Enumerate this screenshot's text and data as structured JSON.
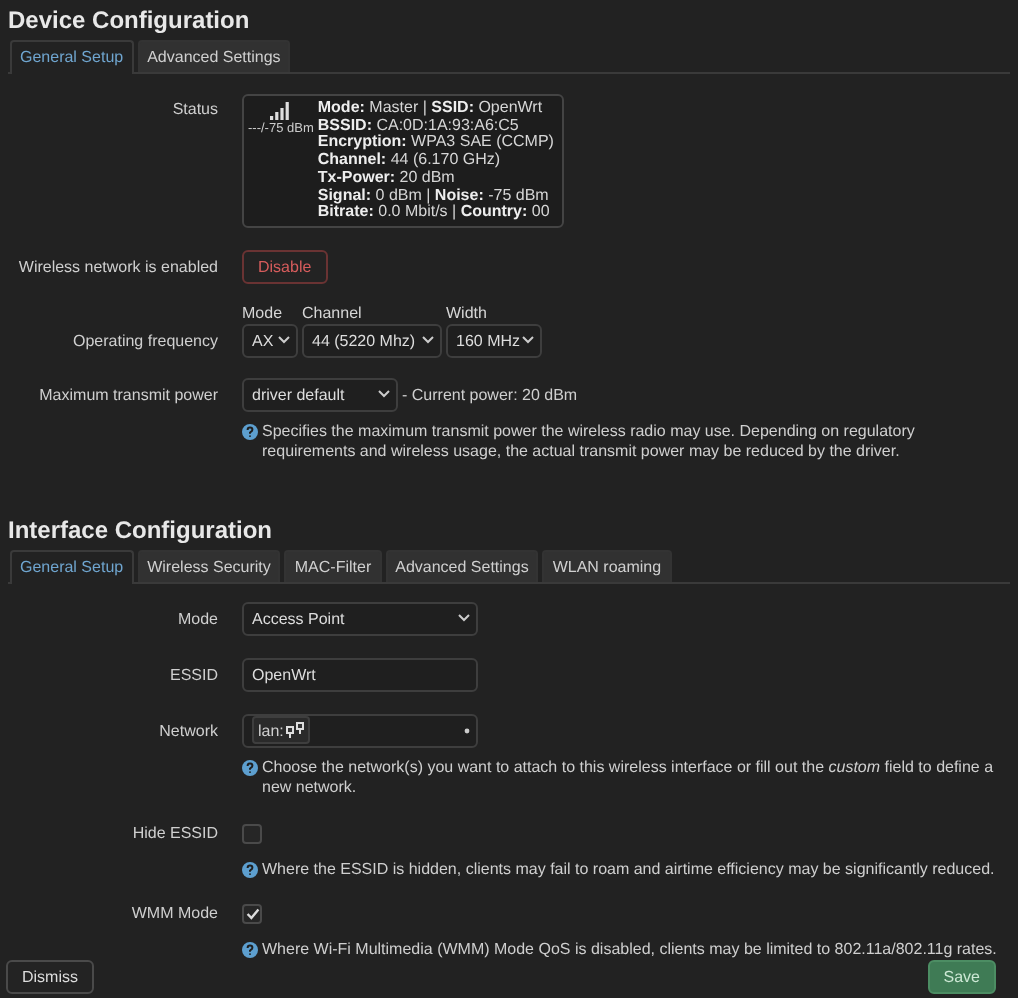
{
  "device": {
    "title": "Device Configuration",
    "tabs": [
      {
        "label": "General Setup",
        "selected": true
      },
      {
        "label": "Advanced Settings",
        "selected": false
      }
    ],
    "status": {
      "label": "Status",
      "signal": "---/-75 dBm",
      "lines": [
        "**Mode:** Master | **SSID:** OpenWrt",
        "**BSSID:** CA:0D:1A:93:A6:C5",
        "**Encryption:** WPA3 SAE (CCMP)",
        "**Channel:** 44 (6.170 GHz)",
        "**Tx-Power:** 20 dBm",
        "**Signal:** 0 dBm | **Noise:** -75 dBm",
        "**Bitrate:** 0.0 Mbit/s | **Country:** 00"
      ]
    },
    "enable": {
      "label": "Wireless network is enabled",
      "button": "Disable"
    },
    "frequency": {
      "label": "Operating frequency",
      "fields": [
        {
          "caption": "Mode",
          "value": "AX"
        },
        {
          "caption": "Channel",
          "value": "44 (5220 Mhz)"
        },
        {
          "caption": "Width",
          "value": "160 MHz"
        }
      ]
    },
    "txpower": {
      "label": "Maximum transmit power",
      "value": "driver default",
      "current": "- Current power: 20 dBm",
      "help": "Specifies the maximum transmit power the wireless radio may use. Depending on regulatory requirements and wireless usage, the actual transmit power may be reduced by the driver."
    }
  },
  "interface": {
    "title": "Interface Configuration",
    "tabs": [
      {
        "label": "General Setup",
        "selected": true
      },
      {
        "label": "Wireless Security",
        "selected": false
      },
      {
        "label": "MAC-Filter",
        "selected": false
      },
      {
        "label": "Advanced Settings",
        "selected": false
      },
      {
        "label": "WLAN roaming",
        "selected": false
      }
    ],
    "fields": [
      {
        "kind": "select",
        "label": "Mode",
        "value": "Access Point"
      },
      {
        "kind": "input",
        "label": "ESSID",
        "value": "OpenWrt"
      },
      {
        "kind": "network",
        "label": "Network",
        "value": "lan:",
        "help": "Choose the network(s) you want to attach to this wireless interface or fill out the *custom* field to define a new network."
      },
      {
        "kind": "checkbox",
        "label": "Hide ESSID",
        "checked": false,
        "help": "Where the ESSID is hidden, clients may fail to roam and airtime efficiency may be significantly reduced."
      },
      {
        "kind": "checkbox",
        "label": "WMM Mode",
        "checked": true,
        "help": "Where Wi-Fi Multimedia (WMM) Mode QoS is disabled, clients may be limited to 802.11a/802.11g rates."
      }
    ]
  },
  "footer": {
    "dismiss": "Dismiss",
    "save": "Save"
  }
}
